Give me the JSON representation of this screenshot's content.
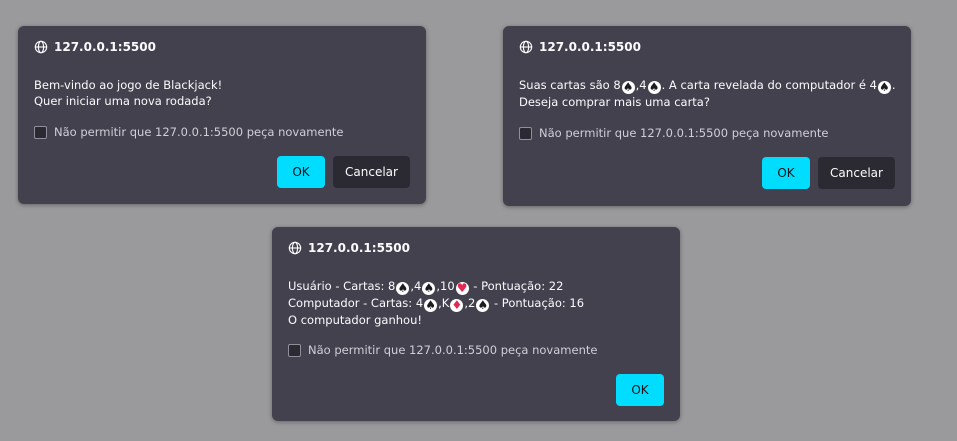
{
  "dialogs": [
    {
      "origin": "127.0.0.1:5500",
      "lines": [
        {
          "text": "Bem-vindo ao jogo de Blackjack!"
        },
        {
          "text": "Quer iniciar uma nova rodada?"
        }
      ],
      "checkbox_label": "Não permitir que 127.0.0.1:5500 peça novamente",
      "checkbox_checked": false,
      "ok_label": "OK",
      "cancel_label": "Cancelar"
    },
    {
      "origin": "127.0.0.1:5500",
      "line1": {
        "t1": "Suas cartas são 8",
        "t2": ",4",
        "t3": ". A carta revelada do computador é 4",
        "t4": "."
      },
      "line2": "Deseja comprar mais uma carta?",
      "checkbox_label": "Não permitir que 127.0.0.1:5500 peça novamente",
      "checkbox_checked": false,
      "ok_label": "OK",
      "cancel_label": "Cancelar"
    },
    {
      "origin": "127.0.0.1:5500",
      "line1": {
        "t1": "Usuário - Cartas: 8",
        "t2": ",4",
        "t3": ",10",
        "t4": " - Pontuação: 22"
      },
      "line2": {
        "t1": "Computador - Cartas: 4",
        "t2": ",K",
        "t3": ",2",
        "t4": " - Pontuação: 16"
      },
      "line3": "O computador ganhou!",
      "checkbox_label": "Não permitir que 127.0.0.1:5500 peça novamente",
      "checkbox_checked": false,
      "ok_label": "OK"
    }
  ],
  "suits": {
    "spade": "♠",
    "heart": "♥",
    "diamond": "♦"
  },
  "colors": {
    "background": "#9a9a9c",
    "dialog": "#42414d",
    "ok_button": "#00ddff",
    "cancel_button": "#2b2a33",
    "suit_red": "#e22850"
  }
}
